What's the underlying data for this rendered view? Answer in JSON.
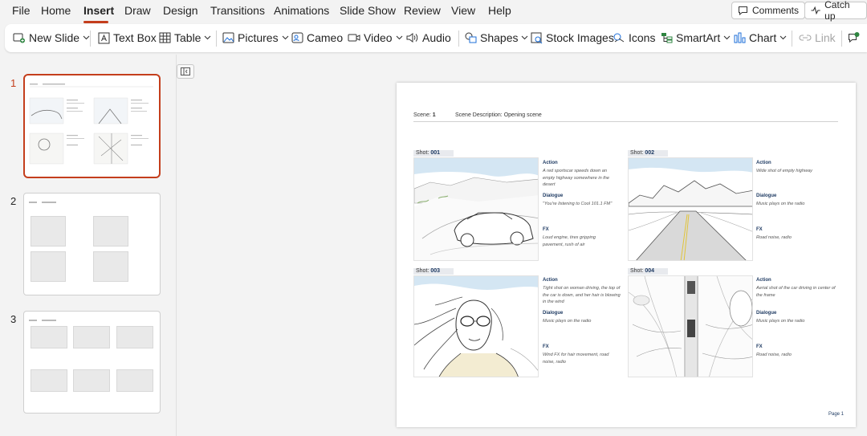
{
  "menu": {
    "items": [
      "File",
      "Home",
      "Insert",
      "Draw",
      "Design",
      "Transitions",
      "Animations",
      "Slide Show",
      "Review",
      "View",
      "Help"
    ],
    "active": "Insert",
    "comments_label": "Comments",
    "catchup_label": "Catch up"
  },
  "ribbon": {
    "new_slide": "New Slide",
    "text_box": "Text Box",
    "table": "Table",
    "pictures": "Pictures",
    "cameo": "Cameo",
    "video": "Video",
    "audio": "Audio",
    "shapes": "Shapes",
    "stock_images": "Stock Images",
    "icons": "Icons",
    "smartart": "SmartArt",
    "chart": "Chart",
    "link": "Link"
  },
  "thumbnails": [
    {
      "number": "1",
      "selected": true
    },
    {
      "number": "2",
      "selected": false
    },
    {
      "number": "3",
      "selected": false
    }
  ],
  "slide": {
    "scene_label": "Scene:",
    "scene_value": "1",
    "description_label": "Scene Description:",
    "description_value": "Opening scene",
    "shot_label": "Shot:",
    "action_label": "Action",
    "dialogue_label": "Dialogue",
    "fx_label": "FX",
    "page": "Page 1",
    "shots": [
      {
        "number": "001",
        "action": "A red sportscar speeds down an empty highway somewhere in the desert",
        "dialogue": "\"You're listening to Cool 101.1 FM\"",
        "fx": "Loud engine, tires gripping pavement, rush of air"
      },
      {
        "number": "002",
        "action": "Wide shot of empty highway",
        "dialogue": "Music plays on the radio",
        "fx": "Road noise, radio"
      },
      {
        "number": "003",
        "action": "Tight shot on woman driving, the top of the car is down, and her hair is blowing in the wind",
        "dialogue": "Music plays on the radio",
        "fx": "Wind FX for hair movement, road noise, radio"
      },
      {
        "number": "004",
        "action": "Aerial shot of the car driving in center of the frame",
        "dialogue": "Music plays on the radio",
        "fx": "Road noise, radio"
      }
    ]
  },
  "colors": {
    "accent": "#c43e1c",
    "heading_blue": "#1f3b63"
  }
}
